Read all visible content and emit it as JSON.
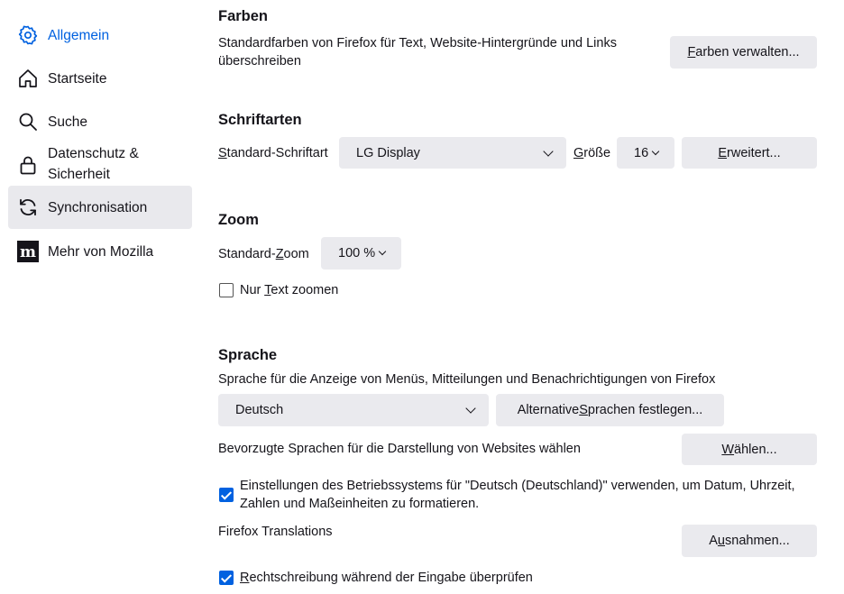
{
  "sidebar": {
    "items": [
      {
        "label": "Allgemein",
        "icon": "gear-icon"
      },
      {
        "label": "Startseite",
        "icon": "home-icon"
      },
      {
        "label": "Suche",
        "icon": "search-icon"
      },
      {
        "label": "Datenschutz &\nSicherheit",
        "icon": "lock-icon"
      },
      {
        "label": "Synchronisation",
        "icon": "sync-icon"
      },
      {
        "label": "Mehr von Mozilla",
        "icon": "mozilla-icon"
      }
    ]
  },
  "farben": {
    "heading": "Farben",
    "description": "Standardfarben von Firefox für Text, Website-Hintergründe und Links\nüberschreiben",
    "manage_button": {
      "pre": "",
      "key": "F",
      "post": "arben verwalten..."
    }
  },
  "fonts": {
    "heading": "Schriftarten",
    "default_font_label": {
      "pre": "",
      "key": "S",
      "post": "tandard-Schriftart"
    },
    "default_font_value": "LG Display",
    "size_label": {
      "pre": "",
      "key": "G",
      "post": "röße"
    },
    "size_value": "16",
    "advanced_button": {
      "pre": "",
      "key": "E",
      "post": "rweitert..."
    }
  },
  "zoom": {
    "heading": "Zoom",
    "default_zoom_label": {
      "pre": "Standard-",
      "key": "Z",
      "post": "oom"
    },
    "default_zoom_value": "100 %",
    "text_only_label": {
      "pre": "Nur ",
      "key": "T",
      "post": "ext zoomen"
    },
    "text_only_checked": false
  },
  "language": {
    "heading": "Sprache",
    "description": "Sprache für die Anzeige von Menüs, Mitteilungen und Benachrichtigungen von Firefox",
    "ui_language_value": "Deutsch",
    "alt_languages_button": {
      "pre": "Alternative ",
      "key": "S",
      "post": "prachen festlegen..."
    },
    "preferred_label": "Bevorzugte Sprachen für die Darstellung von Websites wählen",
    "choose_button": {
      "pre": "",
      "key": "W",
      "post": "ählen..."
    },
    "os_settings_label": "Einstellungen des Betriebssystems für \"Deutsch (Deutschland)\" verwenden, um Datum, Uhrzeit,\nZahlen und Maßeinheiten zu formatieren.",
    "os_settings_checked": true,
    "translations_label": "Firefox Translations",
    "exceptions_button": {
      "pre": "A",
      "key": "u",
      "post": "snahmen..."
    },
    "spellcheck_label": {
      "pre": "",
      "key": "R",
      "post": "echtschreibung während der Eingabe überprüfen"
    },
    "spellcheck_checked": true
  },
  "colors": {
    "accent": "#0061e0",
    "button_bg": "#eaeaee",
    "selected_bg": "#e9e9ed"
  }
}
